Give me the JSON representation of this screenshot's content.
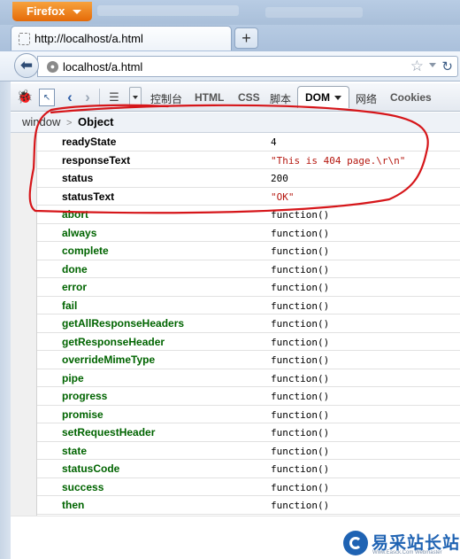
{
  "browser": {
    "app_menu_label": "Firefox",
    "tab_title": "http://localhost/a.html",
    "new_tab_label": "+",
    "url": "localhost/a.html"
  },
  "firebug": {
    "tabs": {
      "console": "控制台",
      "html": "HTML",
      "css": "CSS",
      "script": "脚本",
      "dom": "DOM",
      "net": "网络",
      "cookies": "Cookies"
    },
    "breadcrumb": {
      "root": "window",
      "separator": ">",
      "current": "Object"
    }
  },
  "dom_properties": [
    {
      "name": "readyState",
      "value": "4",
      "kind": "number"
    },
    {
      "name": "responseText",
      "value": "\"This is 404 page.\\r\\n\"",
      "kind": "string"
    },
    {
      "name": "status",
      "value": "200",
      "kind": "number"
    },
    {
      "name": "statusText",
      "value": "\"OK\"",
      "kind": "string"
    },
    {
      "name": "abort",
      "value": "function()",
      "kind": "function"
    },
    {
      "name": "always",
      "value": "function()",
      "kind": "function"
    },
    {
      "name": "complete",
      "value": "function()",
      "kind": "function"
    },
    {
      "name": "done",
      "value": "function()",
      "kind": "function"
    },
    {
      "name": "error",
      "value": "function()",
      "kind": "function"
    },
    {
      "name": "fail",
      "value": "function()",
      "kind": "function"
    },
    {
      "name": "getAllResponseHeaders",
      "value": "function()",
      "kind": "function"
    },
    {
      "name": "getResponseHeader",
      "value": "function()",
      "kind": "function"
    },
    {
      "name": "overrideMimeType",
      "value": "function()",
      "kind": "function"
    },
    {
      "name": "pipe",
      "value": "function()",
      "kind": "function"
    },
    {
      "name": "progress",
      "value": "function()",
      "kind": "function"
    },
    {
      "name": "promise",
      "value": "function()",
      "kind": "function"
    },
    {
      "name": "setRequestHeader",
      "value": "function()",
      "kind": "function"
    },
    {
      "name": "state",
      "value": "function()",
      "kind": "function"
    },
    {
      "name": "statusCode",
      "value": "function()",
      "kind": "function"
    },
    {
      "name": "success",
      "value": "function()",
      "kind": "function"
    },
    {
      "name": "then",
      "value": "function()",
      "kind": "function"
    }
  ],
  "colors": {
    "annotation": "#d6161a",
    "function_name": "#006400",
    "string_value": "#b5170f",
    "firefox_button": "#e56a08"
  },
  "watermark": {
    "text": "易采站长站",
    "subtext": "Www.Easck.Com  Webmaster"
  }
}
